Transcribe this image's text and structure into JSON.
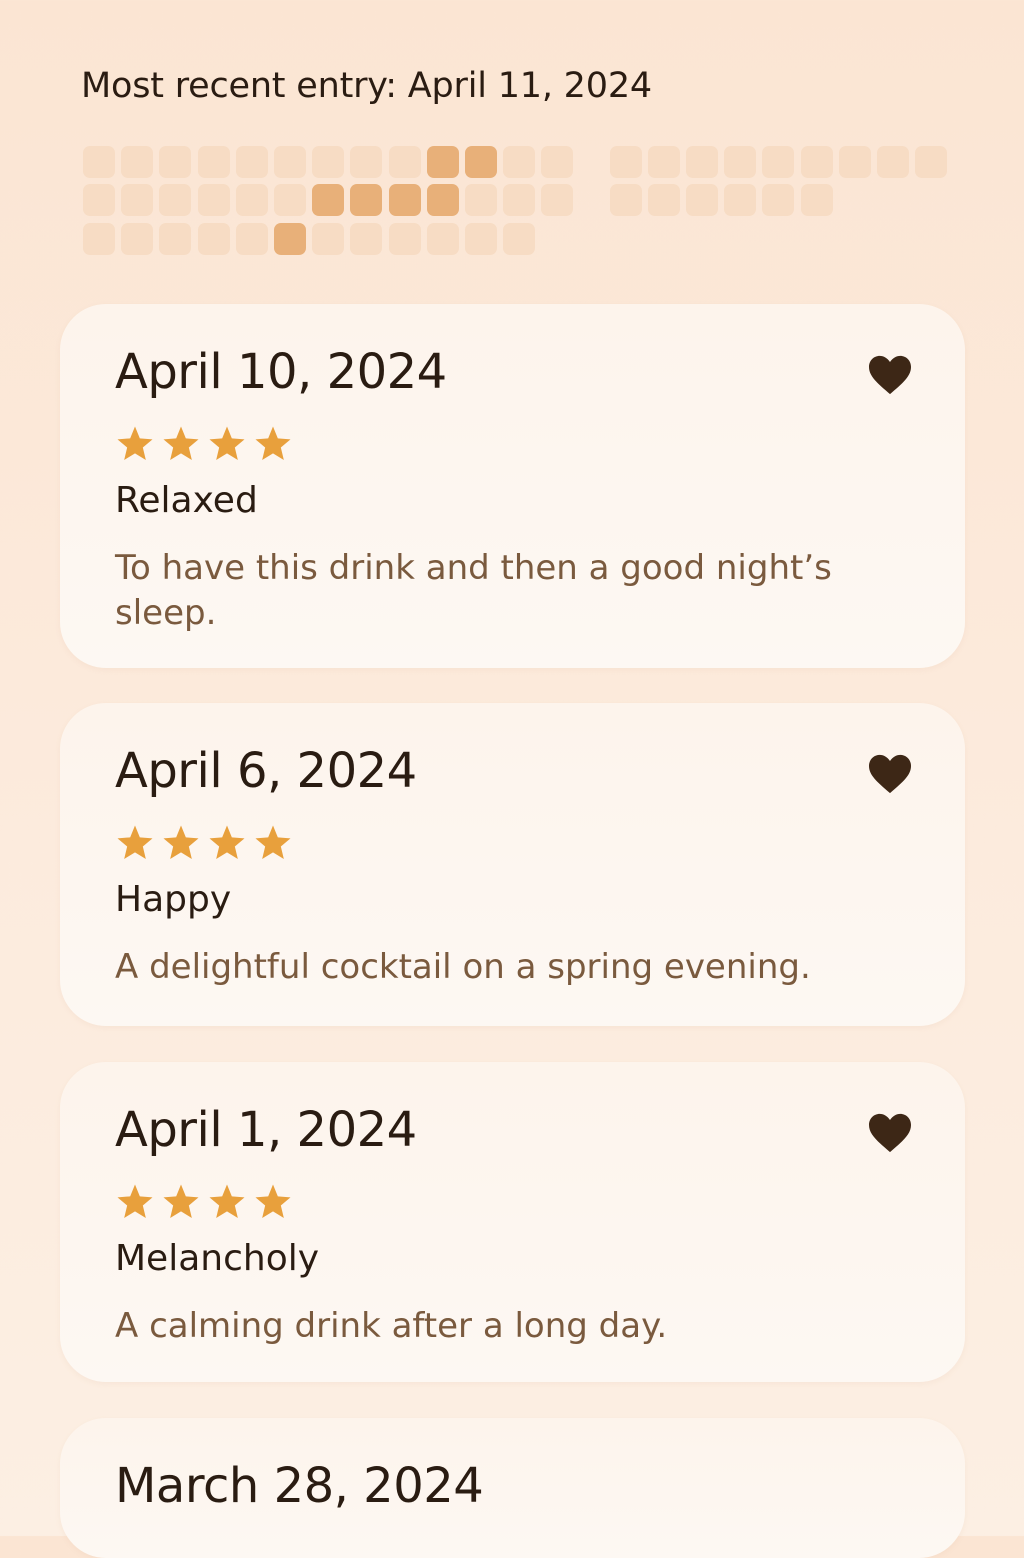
{
  "header": {
    "recent_entry": "Most recent entry: April 11, 2024"
  },
  "heatmap": {
    "rows": [
      [
        0,
        0,
        0,
        0,
        0,
        0,
        0,
        0,
        0,
        1,
        1,
        0,
        0,
        null,
        0,
        0,
        0,
        0,
        0,
        0,
        0,
        0,
        0
      ],
      [
        0,
        0,
        0,
        0,
        0,
        0,
        1,
        1,
        1,
        1,
        0,
        0,
        0,
        null,
        0,
        0,
        0,
        0,
        0,
        0
      ],
      [
        0,
        0,
        0,
        0,
        0,
        1,
        0,
        0,
        0,
        0,
        0,
        0
      ]
    ],
    "colors": {
      "empty": "#f7dcc4",
      "filled": "#e8b079"
    }
  },
  "entries": [
    {
      "date": "April 10, 2024",
      "rating": 4,
      "mood": "Relaxed",
      "note": "To have this drink and then a good night’s sleep.",
      "favorite": true
    },
    {
      "date": "April 6, 2024",
      "rating": 4,
      "mood": "Happy",
      "note": "A delightful cocktail on a spring evening.",
      "favorite": true
    },
    {
      "date": "April 1, 2024",
      "rating": 4,
      "mood": "Melancholy",
      "note": "A calming drink after a long day.",
      "favorite": true
    },
    {
      "date": "March 28, 2024"
    }
  ],
  "icons": {
    "favorite": "heart-icon",
    "rating": "star-icon"
  },
  "colors": {
    "star": "#e8a03c",
    "heart": "#3d2716",
    "text": "#2a1c12",
    "note": "#7a5a3e"
  }
}
